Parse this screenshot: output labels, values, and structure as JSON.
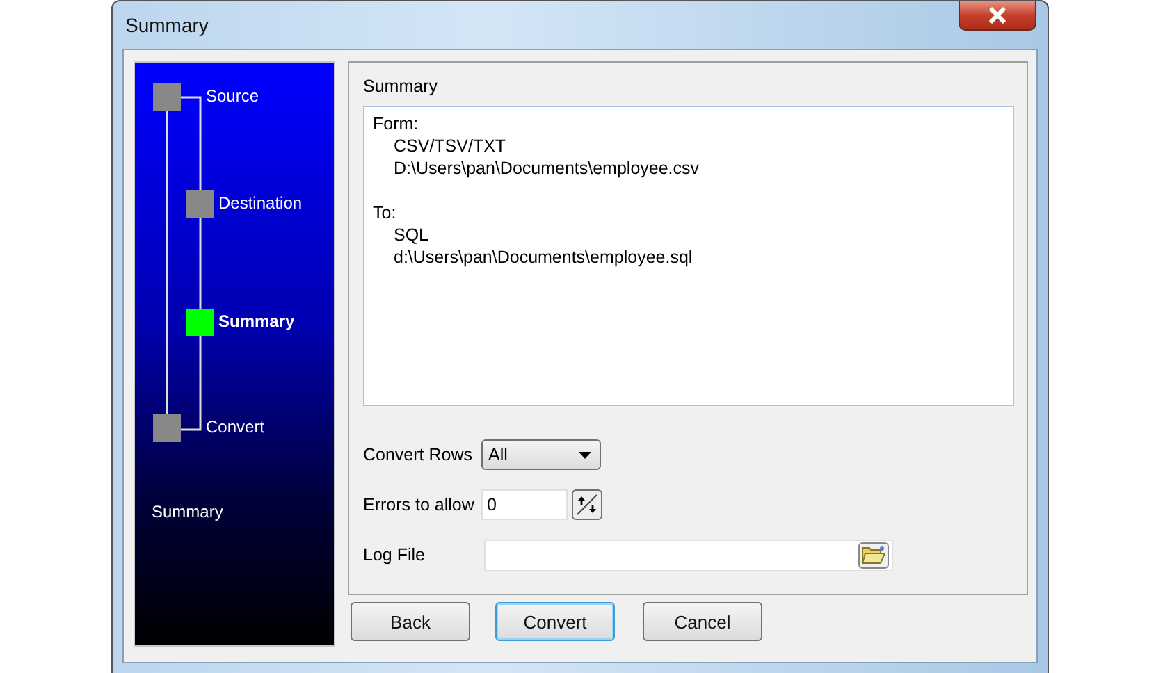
{
  "window": {
    "title": "Summary"
  },
  "steps": [
    {
      "label": "Source",
      "kind": "main",
      "selected": false
    },
    {
      "label": "Destination",
      "kind": "sub",
      "selected": false
    },
    {
      "label": "Summary",
      "kind": "sub",
      "selected": true
    },
    {
      "label": "Convert",
      "kind": "main",
      "selected": false
    }
  ],
  "step_caption": "Summary",
  "panel": {
    "title": "Summary",
    "sections": [
      {
        "heading": "Form:",
        "items": [
          "CSV/TSV/TXT",
          "D:\\Users\\pan\\Documents\\employee.csv"
        ]
      },
      {
        "heading": "To:",
        "items": [
          "SQL",
          "d:\\Users\\pan\\Documents\\employee.sql"
        ]
      }
    ],
    "convert_rows": {
      "label": "Convert Rows",
      "value": "All"
    },
    "errors_to_allow": {
      "label": "Errors to allow",
      "value": "0"
    },
    "log_file": {
      "label": "Log File"
    }
  },
  "buttons": [
    {
      "label": "Back",
      "focused": false
    },
    {
      "label": "Convert",
      "focused": true
    },
    {
      "label": "Cancel",
      "focused": false
    }
  ]
}
